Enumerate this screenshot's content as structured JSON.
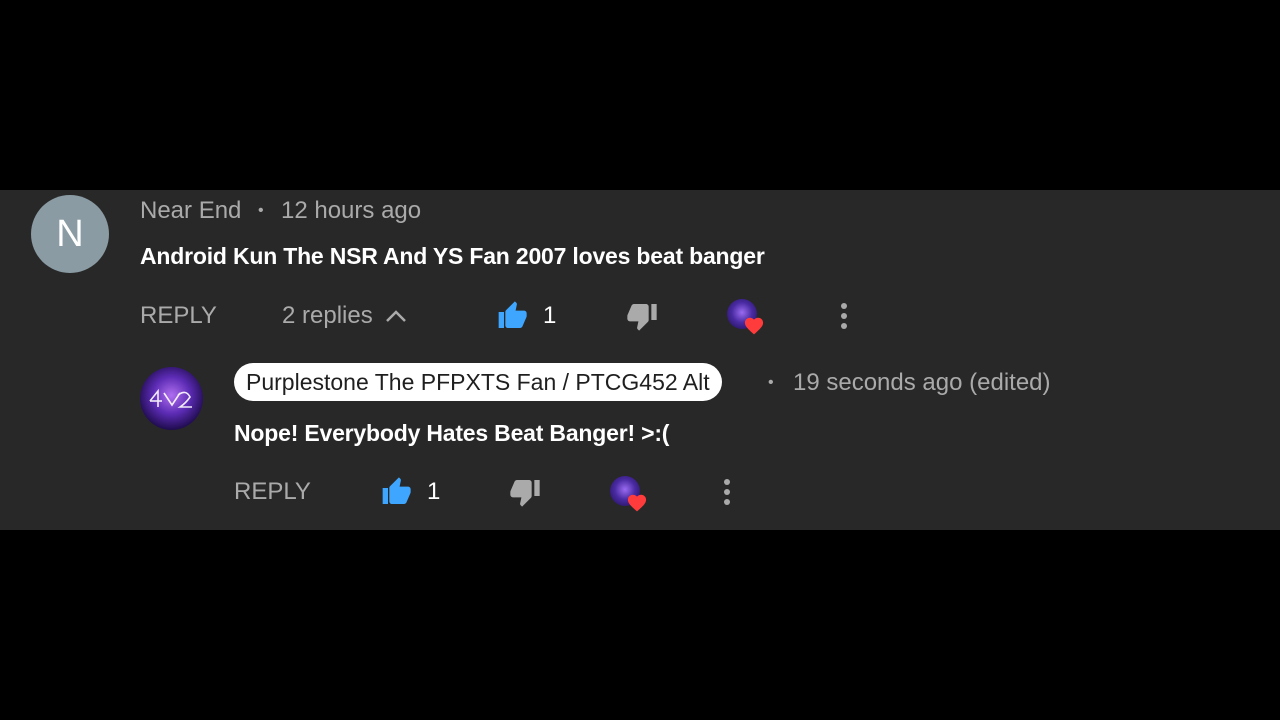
{
  "colors": {
    "background": "#000000",
    "panel": "#282828",
    "muted_text": "#aaaaaa",
    "like_blue": "#3ea6ff",
    "heart_red": "#ff3b3b",
    "avatar_grey": "#8a9ba3"
  },
  "comment": {
    "avatar_letter": "N",
    "author": "Near End",
    "separator": "•",
    "time": "12 hours ago",
    "text": "Android Kun The NSR And YS Fan 2007 loves beat banger",
    "reply_label": "REPLY",
    "replies_label": "2 replies",
    "like_count": "1",
    "icons": [
      "thumbs-up-icon",
      "thumbs-down-icon",
      "creator-heart-icon",
      "more-vert-icon",
      "chevron-up-icon"
    ]
  },
  "reply": {
    "author": "Purplestone The PFPXTS Fan / PTCG452 Alt",
    "separator": "•",
    "time": "19 seconds ago (edited)",
    "text": "Nope! Everybody Hates Beat Banger! >:(",
    "reply_label": "REPLY",
    "like_count": "1",
    "icons": [
      "thumbs-up-icon",
      "thumbs-down-icon",
      "creator-heart-icon",
      "more-vert-icon"
    ]
  }
}
